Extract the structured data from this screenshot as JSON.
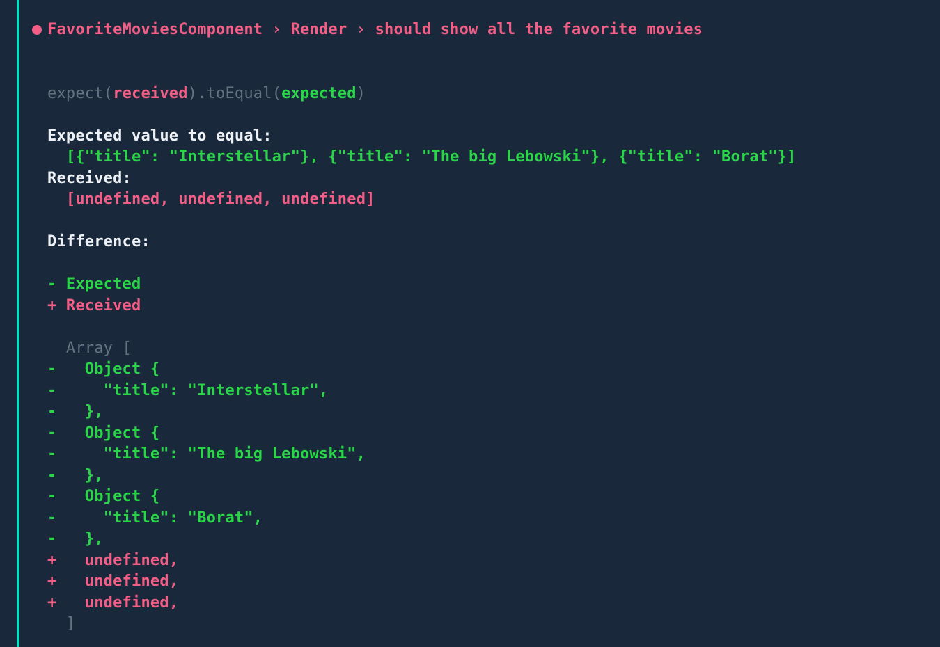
{
  "test": {
    "b0": "FavoriteMoviesComponent",
    "sep1": " › ",
    "b1": "Render",
    "sep2": " › ",
    "b2": "should show all the favorite movies"
  },
  "assertion": {
    "expect": "expect(",
    "received": "received",
    "closeDot": ").",
    "matcher": "toEqual(",
    "expected": "expected",
    "close": ")"
  },
  "expectedLabel": "Expected value to equal:",
  "expectedValue": "  [{\"title\": \"Interstellar\"}, {\"title\": \"The big Lebowski\"}, {\"title\": \"Borat\"}]",
  "receivedLabel": "Received:",
  "receivedValue": "  [undefined, undefined, undefined]",
  "differenceLabel": "Difference:",
  "legendMinus": "- Expected",
  "legendPlus": "+ Received",
  "arrayOpen": "  Array [",
  "diff": {
    "m1": "-   Object {",
    "m2": "-     \"title\": \"Interstellar\",",
    "m3": "-   },",
    "m4": "-   Object {",
    "m5": "-     \"title\": \"The big Lebowski\",",
    "m6": "-   },",
    "m7": "-   Object {",
    "m8": "-     \"title\": \"Borat\",",
    "m9": "-   },",
    "p1": "+   undefined,",
    "p2": "+   undefined,",
    "p3": "+   undefined,"
  },
  "arrayClose": "  ]"
}
